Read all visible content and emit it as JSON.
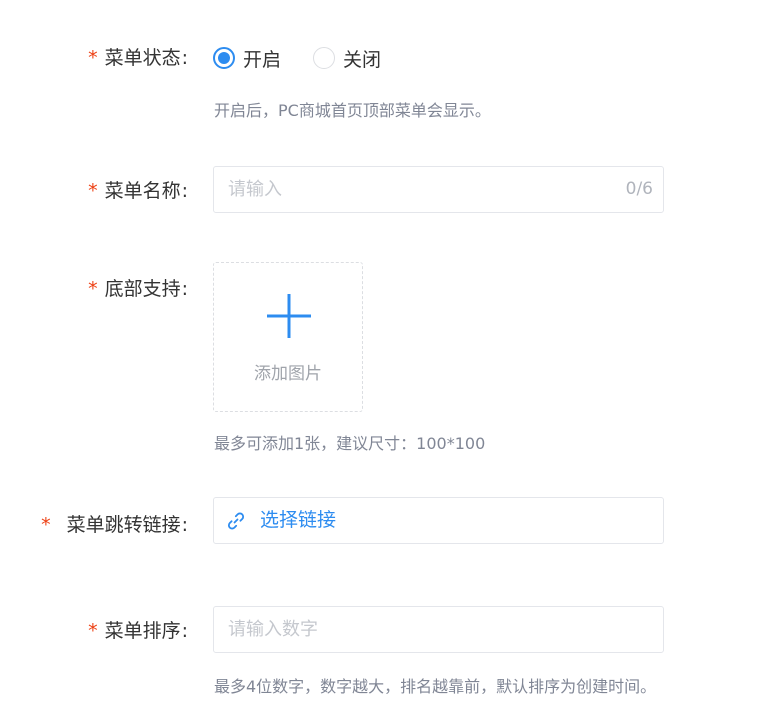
{
  "menu_status": {
    "label": "菜单状态",
    "options": [
      {
        "label": "开启",
        "checked": true
      },
      {
        "label": "关闭",
        "checked": false
      }
    ],
    "hint": "开启后，PC商城首页顶部菜单会显示。"
  },
  "menu_name": {
    "label": "菜单名称",
    "placeholder": "请输入",
    "counter": "0/6"
  },
  "bottom_support": {
    "label": "底部支持",
    "upload_text": "添加图片",
    "hint": "最多可添加1张，建议尺寸：100*100"
  },
  "menu_link": {
    "label": "菜单跳转链接",
    "link_text": "选择链接"
  },
  "menu_sort": {
    "label": "菜单排序",
    "placeholder": "请输入数字",
    "hint": "最多4位数字，数字越大，排名越靠前，默认排序为创建时间。"
  },
  "required_mark": "*",
  "colon": ":",
  "colors": {
    "primary": "#2d8cf0",
    "required": "#ed4014",
    "hint": "#808695",
    "border": "#e4e6eb"
  },
  "icons": {
    "upload": "plus-icon",
    "link": "link-icon"
  }
}
